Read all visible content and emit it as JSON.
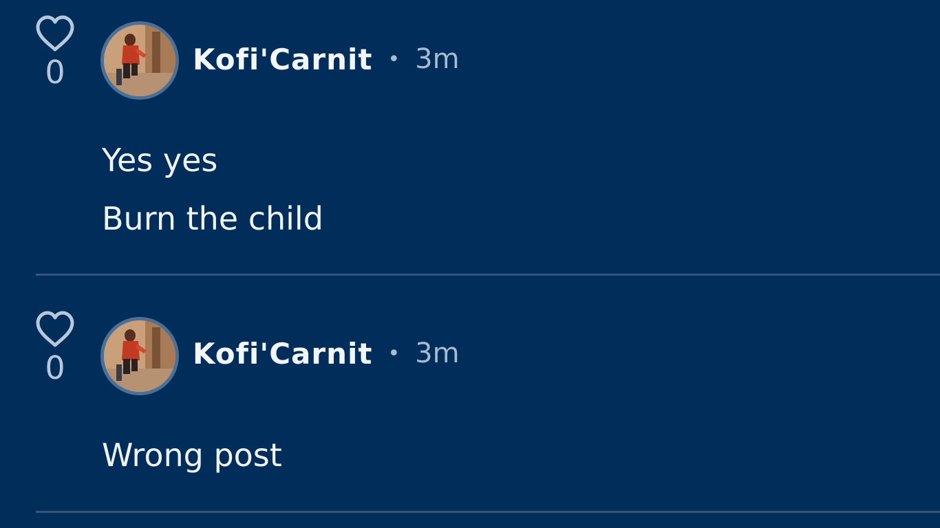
{
  "colors": {
    "background": "#002d5a",
    "divider": "#35577e",
    "muted": "#a9bbd0",
    "text": "#f0f4f8"
  },
  "comments": [
    {
      "likes": "0",
      "like_icon": "heart-outline-icon",
      "author": "Kofi'Carnit",
      "separator": "•",
      "time": "3m",
      "lines": [
        "Yes yes",
        "Burn the child"
      ]
    },
    {
      "likes": "0",
      "like_icon": "heart-outline-icon",
      "author": "Kofi'Carnit",
      "separator": "•",
      "time": "3m",
      "lines": [
        "Wrong post"
      ]
    }
  ]
}
